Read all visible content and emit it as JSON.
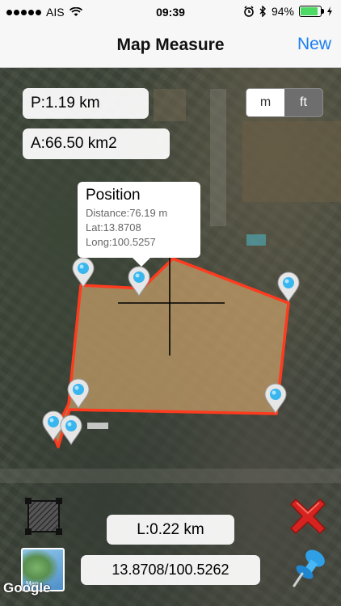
{
  "status_bar": {
    "carrier": "AIS",
    "time": "09:39",
    "battery": "94%"
  },
  "nav": {
    "title": "Map Measure",
    "new_label": "New"
  },
  "measure": {
    "perimeter": "P:1.19 km",
    "area": "A:66.50 km2",
    "length": "L:0.22 km",
    "coords": "13.8708/100.5262"
  },
  "units": {
    "m": "m",
    "ft": "ft",
    "selected": "ft"
  },
  "callout": {
    "title": "Position",
    "distance": "Distance:76.19 m",
    "lat": "Lat:13.8708",
    "long": "Long:100.5257"
  },
  "map": {
    "map_type_label": "Map",
    "attribution": "Google"
  },
  "icons": {
    "draw": "polygon-draw-icon",
    "maptype": "map-type-icon",
    "close": "close-x-icon",
    "pin": "pushpin-icon"
  },
  "colors": {
    "polygon_stroke": "#ff3b1f",
    "polygon_fill": "#c9a06a",
    "pin": "#3ab6ef",
    "accent": "#1a7ef2",
    "close": "#d6231f"
  }
}
